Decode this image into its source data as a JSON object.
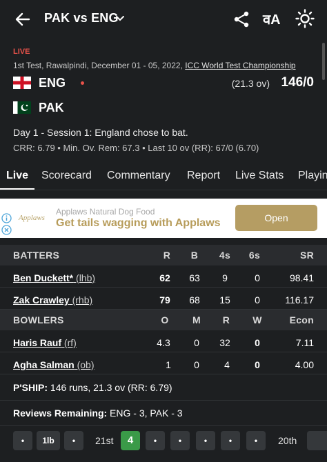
{
  "header": {
    "title": "PAK vs ENG",
    "lang_label": "वA"
  },
  "match": {
    "live_label": "LIVE",
    "info": "1st Test, Rawalpindi, December 01 - 05, 2022, ",
    "series": "ICC World Test Championship",
    "teams": [
      {
        "name": "ENG",
        "overs": "(21.3 ov)",
        "score": "146/0"
      },
      {
        "name": "PAK",
        "overs": "",
        "score": ""
      }
    ],
    "status": "Day 1 - Session 1: England chose to bat.",
    "rates": "CRR: 6.79 • Min. Ov. Rem: 67.3 • Last 10 ov (RR): 67/0 (6.70)"
  },
  "tabs": [
    "Live",
    "Scorecard",
    "Commentary",
    "Report",
    "Live Stats",
    "Playing XI"
  ],
  "ad": {
    "logo": "Applaws",
    "advertiser": "Applaws Natural Dog Food",
    "headline": "Get tails wagging with Applaws",
    "button": "Open"
  },
  "batters": {
    "headers": [
      "BATTERS",
      "R",
      "B",
      "4s",
      "6s",
      "SR"
    ],
    "rows": [
      {
        "name": "Ben Duckett*",
        "style": " (lhb)",
        "r": "62",
        "b": "63",
        "fours": "9",
        "sixes": "0",
        "sr": "98.41"
      },
      {
        "name": "Zak Crawley",
        "style": " (rhb)",
        "r": "79",
        "b": "68",
        "fours": "15",
        "sixes": "0",
        "sr": "116.17"
      }
    ]
  },
  "bowlers": {
    "headers": [
      "BOWLERS",
      "O",
      "M",
      "R",
      "W",
      "Econ"
    ],
    "rows": [
      {
        "name": "Haris Rauf",
        "style": " (rf)",
        "o": "4.3",
        "m": "0",
        "r": "32",
        "w": "0",
        "econ": "7.11"
      },
      {
        "name": "Agha Salman",
        "style": " (ob)",
        "o": "1",
        "m": "0",
        "r": "4",
        "w": "0",
        "econ": "4.00"
      }
    ]
  },
  "partnership": {
    "label": "P'SHIP:",
    "value": " 146 runs, 21.3 ov (RR: 6.79)"
  },
  "reviews": {
    "label": "Reviews Remaining:",
    "value": " ENG - 3, PAK - 3"
  },
  "timeline": {
    "over_a": "21st",
    "over_b": "20th",
    "balls_a": [
      "•",
      "1lb",
      "•"
    ],
    "balls_b": [
      "4",
      "•",
      "•",
      "•",
      "•",
      "•"
    ]
  },
  "colors": {
    "background": "#1d1f21",
    "live": "#e8524a",
    "four": "#3a9a48",
    "ad_button": "#b59d63"
  }
}
